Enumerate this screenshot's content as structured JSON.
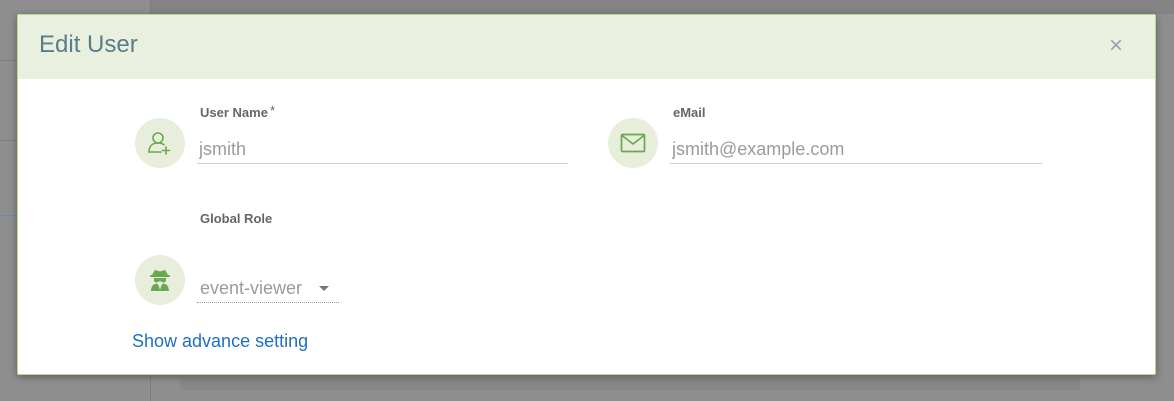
{
  "dialog": {
    "title": "Edit User",
    "close_label": "×"
  },
  "fields": {
    "username": {
      "label": "User Name",
      "required_mark": "*",
      "placeholder": "jsmith",
      "value": ""
    },
    "email": {
      "label": "eMail",
      "placeholder": "jsmith@example.com",
      "value": ""
    },
    "global_role": {
      "label": "Global Role",
      "selected": "event-viewer"
    }
  },
  "links": {
    "advanced": "Show advance setting"
  },
  "icons": {
    "username": "add-user-icon",
    "email": "envelope-icon",
    "role": "spy-user-icon",
    "close": "close-icon"
  },
  "colors": {
    "header_bg": "#eaf0e0",
    "accent_green": "#6aa84f",
    "title": "#5a7d8a",
    "link": "#1e6fc0"
  }
}
